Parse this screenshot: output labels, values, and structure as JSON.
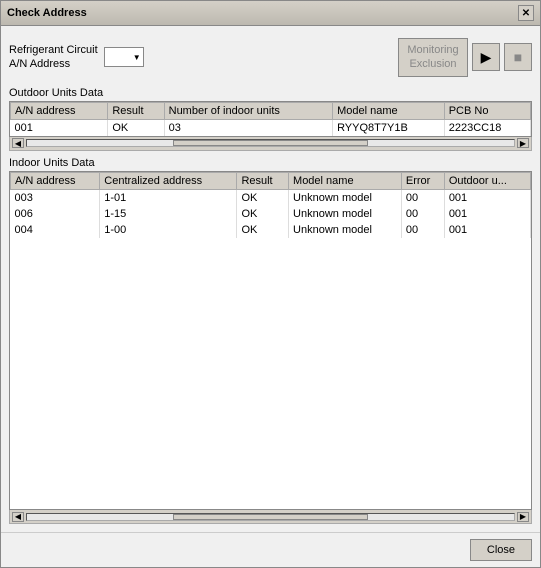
{
  "window": {
    "title": "Check Address",
    "close_label": "✕"
  },
  "controls": {
    "refrigerant_label_line1": "Refrigerant Circuit",
    "refrigerant_label_line2": "A/N Address",
    "monitoring_btn_label": "Monitoring\nExclusion",
    "monitoring_btn_line1": "Monitoring",
    "monitoring_btn_line2": "Exclusion",
    "play_icon": "▶",
    "stop_icon": "■"
  },
  "outdoor_section": {
    "label": "Outdoor Units Data",
    "columns": [
      "A/N address",
      "Result",
      "Number of indoor units",
      "Model name",
      "PCB No"
    ],
    "rows": [
      [
        "001",
        "OK",
        "03",
        "RYYQ8T7Y1B",
        "2223CC18"
      ]
    ]
  },
  "indoor_section": {
    "label": "Indoor Units Data",
    "columns": [
      "A/N address",
      "Centralized address",
      "Result",
      "Model name",
      "Error",
      "Outdoor u..."
    ],
    "rows": [
      [
        "003",
        "1-01",
        "OK",
        "Unknown model",
        "00",
        "001"
      ],
      [
        "006",
        "1-15",
        "OK",
        "Unknown model",
        "00",
        "001"
      ],
      [
        "004",
        "1-00",
        "OK",
        "Unknown model",
        "00",
        "001"
      ]
    ]
  },
  "footer": {
    "close_label": "Close"
  }
}
